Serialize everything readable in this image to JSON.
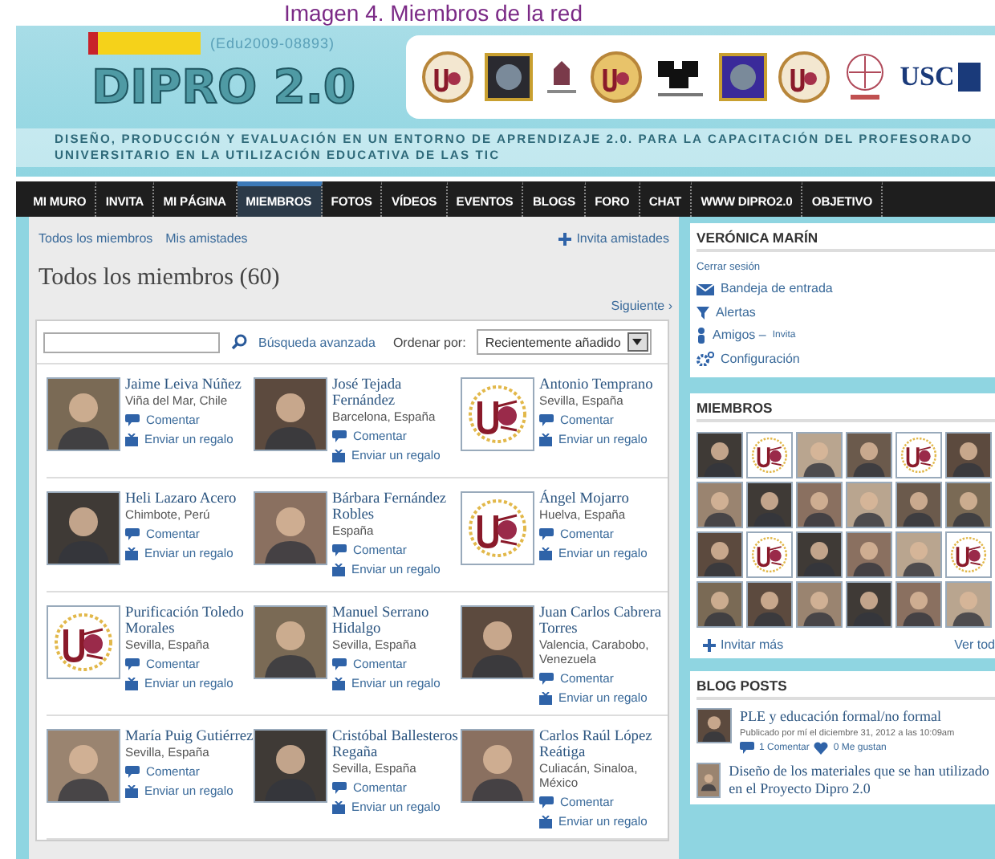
{
  "caption": "Imagen 4. Miembros de la red",
  "header": {
    "project_code": "(Edu2009-08893)",
    "brand": "DIPRO 2.0",
    "tagline": "DISEÑO, PRODUCCIÓN Y EVALUACIÓN  EN UN ENTORNO DE APRENDIZAJE 2.0. PARA LA CAPACITACIÓN DEL PROFESORADO UNIVERSITARIO EN LA UTILIZACIÓN EDUCATIVA DE LAS TIC",
    "logos": [
      {
        "kind": "seal"
      },
      {
        "kind": "square"
      },
      {
        "kind": "tower"
      },
      {
        "kind": "seal"
      },
      {
        "kind": "puzzle"
      },
      {
        "kind": "square"
      },
      {
        "kind": "seal"
      },
      {
        "kind": "compass"
      },
      {
        "kind": "text",
        "label": "USC"
      }
    ]
  },
  "nav": [
    {
      "label": "MI MURO",
      "selected": false
    },
    {
      "label": "INVITA",
      "selected": false
    },
    {
      "label": "MI PÁGINA",
      "selected": false
    },
    {
      "label": "MIEMBROS",
      "selected": true
    },
    {
      "label": "FOTOS",
      "selected": false
    },
    {
      "label": "VÍDEOS",
      "selected": false
    },
    {
      "label": "EVENTOS",
      "selected": false
    },
    {
      "label": "BLOGS",
      "selected": false
    },
    {
      "label": "FORO",
      "selected": false
    },
    {
      "label": "CHAT",
      "selected": false
    },
    {
      "label": "WWW DIPRO2.0",
      "selected": false
    },
    {
      "label": "OBJETIVO",
      "selected": false
    }
  ],
  "main": {
    "links": [
      "Todos los miembros",
      "Mis amistades"
    ],
    "invite": "Invita amistades",
    "title": "Todos los miembros (60)",
    "next": "Siguiente ›",
    "search": {
      "advanced": "Búsqueda avanzada",
      "sort_label": "Ordenar por:",
      "sort_value": "Recientemente añadido"
    },
    "members": [
      {
        "name": "Jaime Leiva Núñez",
        "location": "Viña del Mar, Chile",
        "kind": "photo",
        "comment": "Comentar",
        "gift": "Enviar un regalo"
      },
      {
        "name": "José Tejada Fernández",
        "location": "Barcelona, España",
        "kind": "photo",
        "comment": "Comentar",
        "gift": "Enviar un regalo"
      },
      {
        "name": "Antonio Temprano",
        "location": "Sevilla, España",
        "kind": "logo",
        "comment": "Comentar",
        "gift": "Enviar un regalo"
      },
      {
        "name": "Heli Lazaro Acero",
        "location": "Chimbote, Perú",
        "kind": "photo",
        "comment": "Comentar",
        "gift": "Enviar un regalo"
      },
      {
        "name": "Bárbara Fernández Robles",
        "location": "España",
        "kind": "photo",
        "comment": "Comentar",
        "gift": "Enviar un regalo"
      },
      {
        "name": "Ángel Mojarro",
        "location": "Huelva, España",
        "kind": "logo",
        "comment": "Comentar",
        "gift": "Enviar un regalo"
      },
      {
        "name": "Purificación Toledo Morales",
        "location": "Sevilla, España",
        "kind": "logo",
        "comment": "Comentar",
        "gift": "Enviar un regalo"
      },
      {
        "name": "Manuel Serrano Hidalgo",
        "location": "Sevilla, España",
        "kind": "photo",
        "comment": "Comentar",
        "gift": "Enviar un regalo"
      },
      {
        "name": "Juan Carlos Cabrera Torres",
        "location": "Valencia, Carabobo, Venezuela",
        "kind": "photo",
        "comment": "Comentar",
        "gift": "Enviar un regalo"
      },
      {
        "name": "María Puig Gutiérrez",
        "location": "Sevilla, España",
        "kind": "photo",
        "comment": "Comentar",
        "gift": "Enviar un regalo"
      },
      {
        "name": "Cristóbal Ballesteros Regaña",
        "location": "Sevilla, España",
        "kind": "photo",
        "comment": "Comentar",
        "gift": "Enviar un regalo"
      },
      {
        "name": "Carlos Raúl López Reátiga",
        "location": "Culiacán, Sinaloa, México",
        "kind": "photo",
        "comment": "Comentar",
        "gift": "Enviar un regalo"
      }
    ]
  },
  "sidebar": {
    "user": {
      "name": "VERÓNICA MARÍN",
      "logout": "Cerrar sesión",
      "links": [
        {
          "kind": "inbox",
          "label": "Bandeja de entrada"
        },
        {
          "kind": "alerts",
          "label": "Alertas"
        },
        {
          "kind": "friends",
          "label": "Amigos –",
          "extra": "Invita"
        },
        {
          "kind": "settings",
          "label": "Configuración"
        }
      ]
    },
    "members": {
      "title": "MIEMBROS",
      "thumbs": [
        {
          "kind": "photo"
        },
        {
          "kind": "logo"
        },
        {
          "kind": "photo"
        },
        {
          "kind": "photo"
        },
        {
          "kind": "logo"
        },
        {
          "kind": "photo"
        },
        {
          "kind": "photo"
        },
        {
          "kind": "photo"
        },
        {
          "kind": "photo"
        },
        {
          "kind": "photo"
        },
        {
          "kind": "photo"
        },
        {
          "kind": "photo"
        },
        {
          "kind": "photo"
        },
        {
          "kind": "logo"
        },
        {
          "kind": "photo"
        },
        {
          "kind": "photo"
        },
        {
          "kind": "photo"
        },
        {
          "kind": "logo"
        },
        {
          "kind": "photo"
        },
        {
          "kind": "photo"
        },
        {
          "kind": "photo"
        },
        {
          "kind": "photo"
        },
        {
          "kind": "photo"
        },
        {
          "kind": "photo"
        }
      ],
      "invite": "Invitar más",
      "view_all": "Ver tod"
    },
    "blog": {
      "title": "BLOG POSTS",
      "posts": [
        {
          "title": "PLE y educación formal/no formal",
          "meta": "Publicado por mí el diciembre 31, 2012 a las 10:09am",
          "comments": "1 Comentar",
          "likes": "0 Me gustan"
        },
        {
          "title": "Diseño de los materiales que se han utilizado en el Proyecto Dipro 2.0"
        }
      ]
    }
  }
}
